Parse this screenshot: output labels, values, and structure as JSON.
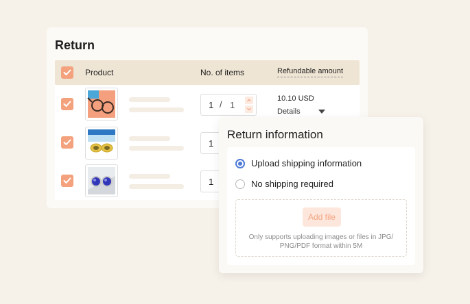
{
  "return_card": {
    "title": "Return",
    "headers": {
      "product": "Product",
      "items": "No. of items",
      "refundable": "Refundable amount"
    },
    "rows": [
      {
        "qty_current": "1",
        "qty_sep": "/",
        "qty_max": "1",
        "amount": "10.10 USD",
        "details": "Details"
      },
      {
        "qty_current": "1"
      },
      {
        "qty_current": "1"
      }
    ]
  },
  "return_info": {
    "title": "Return information",
    "options": [
      "Upload shipping information",
      "No shipping required"
    ],
    "selected_index": 0,
    "add_file_label": "Add file",
    "upload_note": "Only supports uploading images or files in JPG/ PNG/PDF format within 5M"
  },
  "colors": {
    "accent": "#f4a27d",
    "radio": "#4e7ad6",
    "header_bg": "#efe5d4",
    "page_bg": "#f6f1e9"
  }
}
